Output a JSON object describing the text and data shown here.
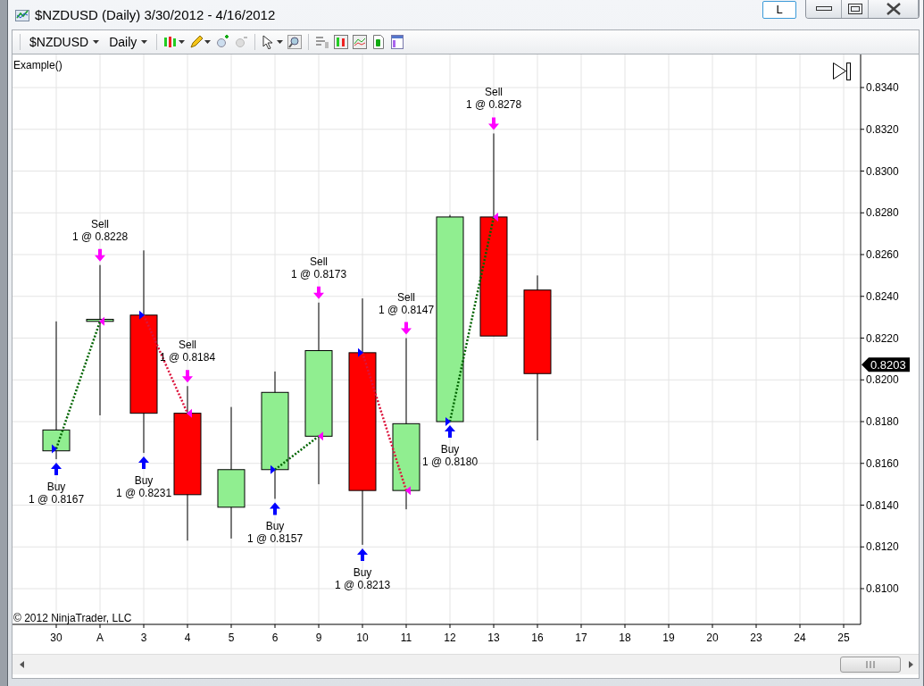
{
  "window": {
    "title": "$NZDUSD (Daily)  3/30/2012 - 4/16/2012",
    "link_button": "L"
  },
  "toolbar": {
    "instrument": "$NZDUSD",
    "interval": "Daily"
  },
  "chart": {
    "indicator": "Example()",
    "copyright": "© 2012 NinjaTrader, LLC",
    "last_price": "0.8203",
    "y_ticks": [
      "0.8340",
      "0.8320",
      "0.8300",
      "0.8280",
      "0.8260",
      "0.8240",
      "0.8220",
      "0.8200",
      "0.8180",
      "0.8160",
      "0.8140",
      "0.8120",
      "0.8100"
    ],
    "x_labels": [
      "30",
      "A",
      "3",
      "4",
      "5",
      "6",
      "9",
      "10",
      "11",
      "12",
      "13",
      "16",
      "17",
      "18",
      "19",
      "20",
      "23",
      "24",
      "25"
    ],
    "trades": [
      {
        "buy_label": "Buy",
        "buy_fill": "1 @ 0.8167",
        "sell_label": "Sell",
        "sell_fill": "1 @ 0.8228",
        "color": "#006400"
      },
      {
        "buy_label": "Buy",
        "buy_fill": "1 @ 0.8231",
        "sell_label": "Sell",
        "sell_fill": "1 @ 0.8184",
        "color": "#dc143c"
      },
      {
        "buy_label": "Buy",
        "buy_fill": "1 @ 0.8157",
        "sell_label": "Sell",
        "sell_fill": "1 @ 0.8173",
        "color": "#006400"
      },
      {
        "buy_label": "Buy",
        "buy_fill": "1 @ 0.8213",
        "sell_label": "Sell",
        "sell_fill": "1 @ 0.8147",
        "color": "#dc143c"
      },
      {
        "buy_label": "Buy",
        "buy_fill": "1 @ 0.8180",
        "sell_label": "Sell",
        "sell_fill": "1 @ 0.8278",
        "color": "#006400"
      }
    ]
  }
}
